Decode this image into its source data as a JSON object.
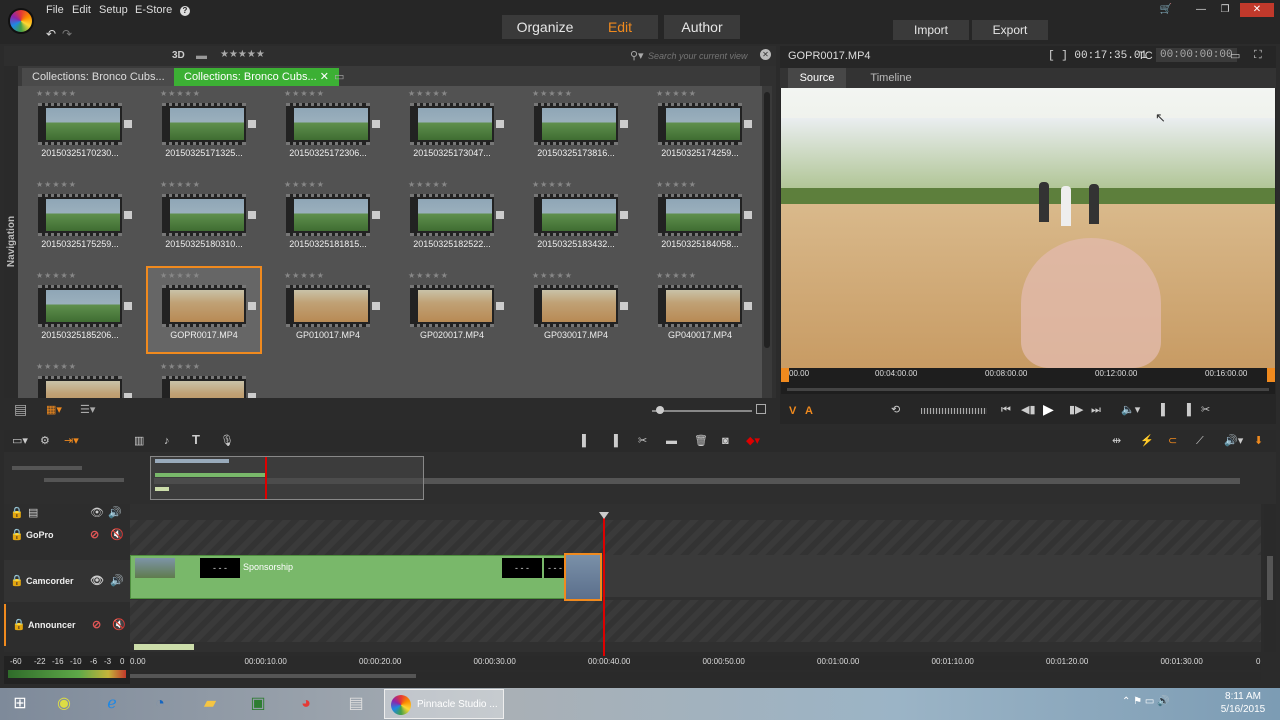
{
  "menu": {
    "file": "File",
    "edit": "Edit",
    "setup": "Setup",
    "estore": "E-Store",
    "help": "?"
  },
  "modes": {
    "organize": "Organize",
    "edit": "Edit",
    "author": "Author"
  },
  "actions": {
    "import": "Import",
    "export": "Export"
  },
  "library": {
    "view_3d": "3D",
    "search_placeholder": "Search your current view",
    "tabs": [
      "Collections: Bronco Cubs...",
      "Collections: Bronco Cubs..."
    ],
    "nav_label": "Navigation",
    "items": [
      {
        "name": "20150325170230...",
        "thumb": "field"
      },
      {
        "name": "20150325171325...",
        "thumb": "field"
      },
      {
        "name": "20150325172306...",
        "thumb": "field"
      },
      {
        "name": "20150325173047...",
        "thumb": "field"
      },
      {
        "name": "20150325173816...",
        "thumb": "field"
      },
      {
        "name": "20150325174259...",
        "thumb": "field"
      },
      {
        "name": "20150325175259...",
        "thumb": "field"
      },
      {
        "name": "20150325180310...",
        "thumb": "field"
      },
      {
        "name": "20150325181815...",
        "thumb": "field"
      },
      {
        "name": "20150325182522...",
        "thumb": "field"
      },
      {
        "name": "20150325183432...",
        "thumb": "field"
      },
      {
        "name": "20150325184058...",
        "thumb": "field"
      },
      {
        "name": "20150325185206...",
        "thumb": "field"
      },
      {
        "name": "GOPR0017.MP4",
        "thumb": "dirt",
        "selected": true
      },
      {
        "name": "GP010017.MP4",
        "thumb": "dirt"
      },
      {
        "name": "GP020017.MP4",
        "thumb": "dirt"
      },
      {
        "name": "GP030017.MP4",
        "thumb": "dirt"
      },
      {
        "name": "GP040017.MP4",
        "thumb": "dirt"
      },
      {
        "name": "",
        "thumb": "dirt"
      },
      {
        "name": "",
        "thumb": "dirt"
      }
    ]
  },
  "player": {
    "file_name": "GOPR0017.MP4",
    "duration": "[ ] 00:17:35.01",
    "tc_label": "TC",
    "timecode": "00:00:00:00",
    "tab_source": "Source",
    "tab_timeline": "Timeline",
    "ruler": [
      "00.00",
      "00:04:00.00",
      "00:08:00.00",
      "00:12:00.00",
      "00:16:00.00"
    ],
    "v_label": "V",
    "a_label": "A"
  },
  "timeline": {
    "tracks": [
      {
        "name": "GoPro"
      },
      {
        "name": "Camcorder"
      },
      {
        "name": "Announcer"
      }
    ],
    "clip_title": "Sponsorship",
    "black_clip_text": "- - -",
    "ruler": [
      "0.00",
      "00:00:10.00",
      "00:00:20.00",
      "00:00:30.00",
      "00:00:40.00",
      "00:00:50.00",
      "00:01:00.00",
      "00:01:10.00",
      "00:01:20.00",
      "00:01:30.00"
    ],
    "meter": [
      "-60",
      "-22",
      "-16",
      "-10",
      "-6",
      "-3",
      "0"
    ],
    "end_label": "0"
  },
  "taskbar": {
    "active_app": "Pinnacle Studio ...",
    "time": "8:11 AM",
    "date": "5/16/2015"
  },
  "colors": {
    "accent": "#f08a1e",
    "clip_green": "#79b86a",
    "playhead": "#dd0000"
  }
}
